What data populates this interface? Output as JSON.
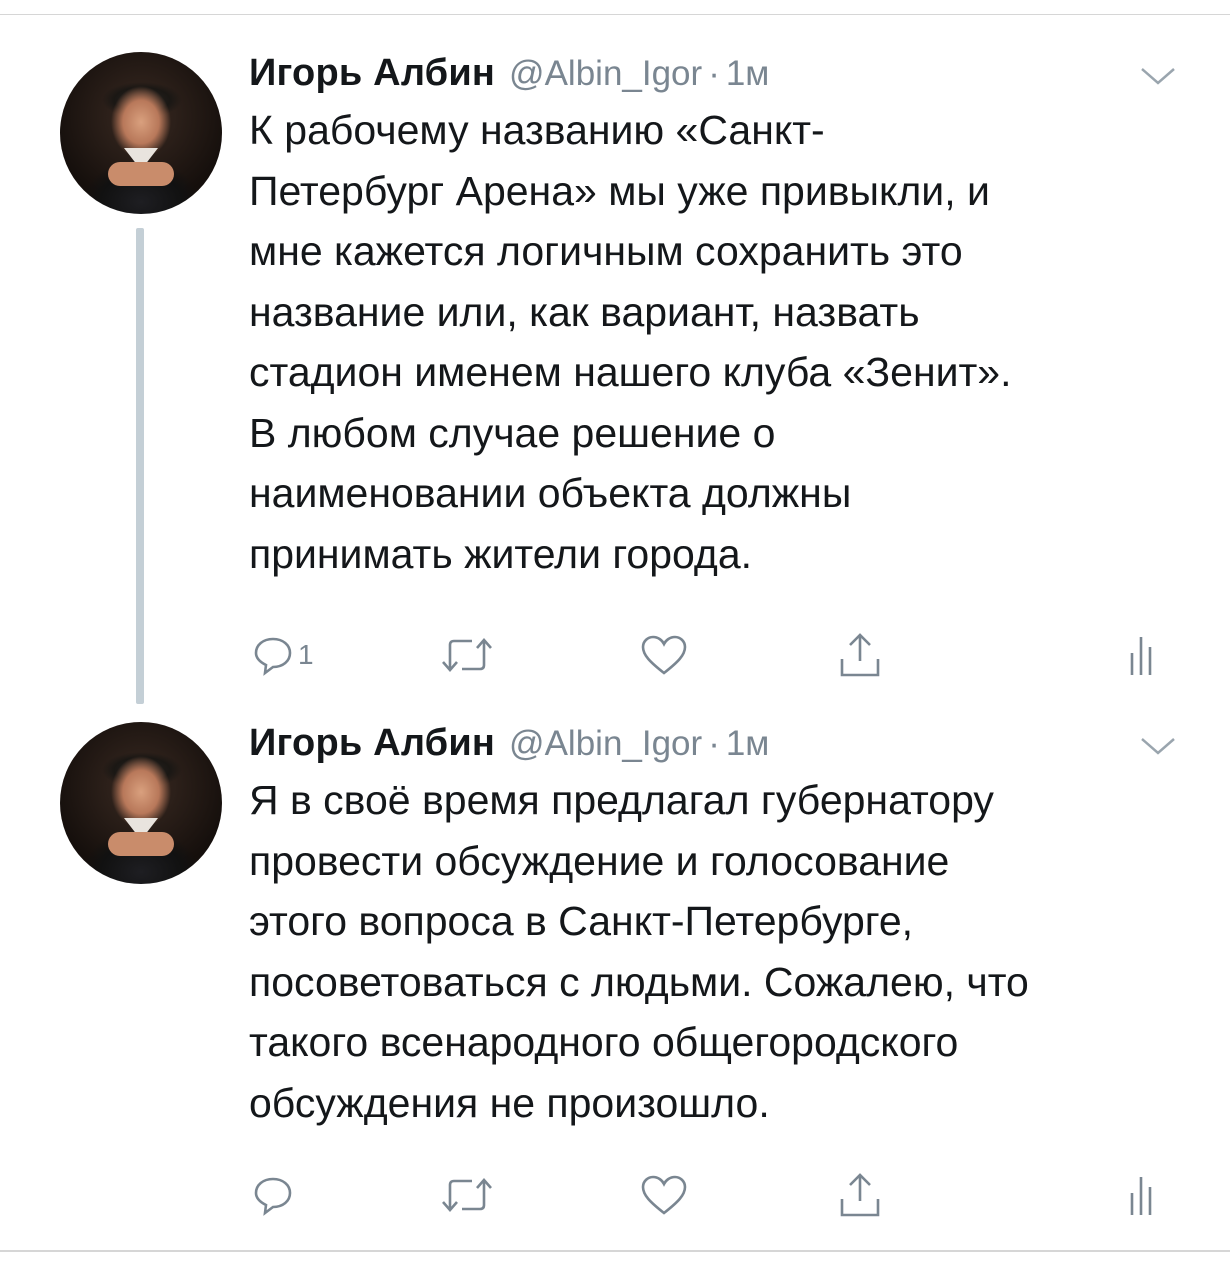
{
  "tweets": [
    {
      "author": {
        "name": "Игорь Албин",
        "handle": "@Albin_Igor",
        "separator": "·",
        "time": "1м"
      },
      "text": "К рабочему названию «Санкт-\nПетербург Арена» мы уже привыкли, и\nмне кажется логичным сохранить это\nназвание или, как вариант, назвать\nстадион именем нашего клуба «Зенит».\nВ любом случае решение о\nнаименовании объекта должны\nпринимать жители города.",
      "actions": {
        "reply_count": "1"
      }
    },
    {
      "author": {
        "name": "Игорь Албин",
        "handle": "@Albin_Igor",
        "separator": "·",
        "time": "1м"
      },
      "text": "Я в своё время предлагал губернатору\nпровести обсуждение и голосование\nэтого вопроса в Санкт-Петербурге,\nпосоветоваться с людьми. Сожалею, что\nтакого всенародного общегородского\nобсуждения не произошло.",
      "actions": {
        "reply_count": ""
      }
    }
  ],
  "icons": {
    "reply": "reply-icon",
    "retweet": "retweet-icon",
    "like": "heart-icon",
    "share": "share-icon",
    "analytics": "analytics-icon",
    "more": "chevron-down-icon"
  },
  "colors": {
    "icon_gray": "#7a8691",
    "thread_line": "#c4cfd6",
    "divider": "#d6d6d6"
  }
}
